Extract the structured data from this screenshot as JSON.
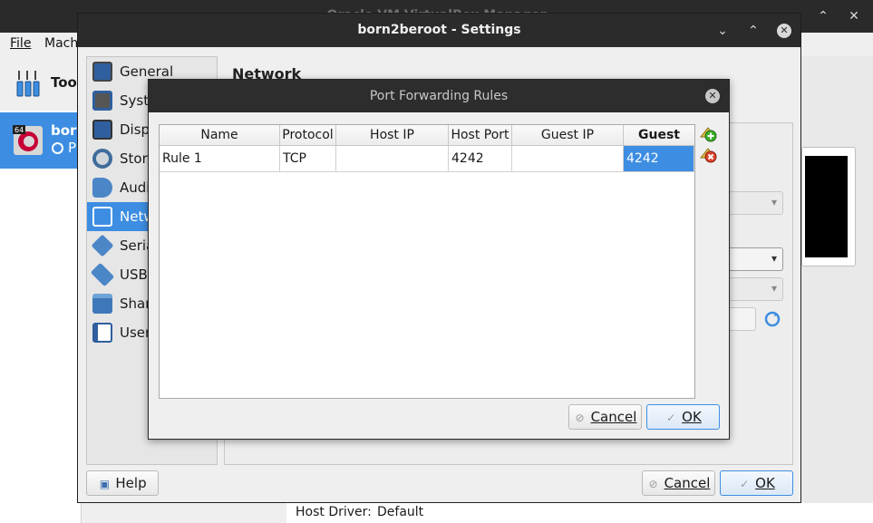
{
  "main_window": {
    "title": "Oracle VM VirtualBox Manager",
    "menu": [
      "File",
      "Mach"
    ],
    "tools_label": "Tool",
    "vm_item": {
      "name": "born",
      "state_prefix": "P",
      "badge": "64"
    },
    "status": {
      "host_driver_label": "Host Driver:",
      "host_driver_value": "Default"
    }
  },
  "settings": {
    "title": "born2beroot - Settings",
    "heading": "Network",
    "sidebar": [
      {
        "label": "General",
        "icon": "general-icon"
      },
      {
        "label": "Syste",
        "icon": "system-icon"
      },
      {
        "label": "Disp",
        "icon": "display-icon"
      },
      {
        "label": "Stora",
        "icon": "storage-icon"
      },
      {
        "label": "Audi",
        "icon": "audio-icon"
      },
      {
        "label": "Netw",
        "icon": "network-icon",
        "selected": true
      },
      {
        "label": "Seria",
        "icon": "serial-ports-icon"
      },
      {
        "label": "USB",
        "icon": "usb-icon"
      },
      {
        "label": "Shar",
        "icon": "shared-folders-icon"
      },
      {
        "label": "User",
        "icon": "user-interface-icon"
      }
    ],
    "help_label": "Help",
    "cancel_label": "Cancel",
    "ok_label": "OK"
  },
  "dialog": {
    "title": "Port Forwarding Rules",
    "columns": [
      "Name",
      "Protocol",
      "Host IP",
      "Host Port",
      "Guest IP",
      "Guest Port"
    ],
    "rows": [
      [
        "Rule 1",
        "TCP",
        "",
        "4242",
        "",
        "4242"
      ]
    ],
    "cancel_label": "Cancel",
    "ok_label": "OK"
  },
  "colors": {
    "accent": "#3d8ee2",
    "titlebar": "#2b2b2b"
  }
}
